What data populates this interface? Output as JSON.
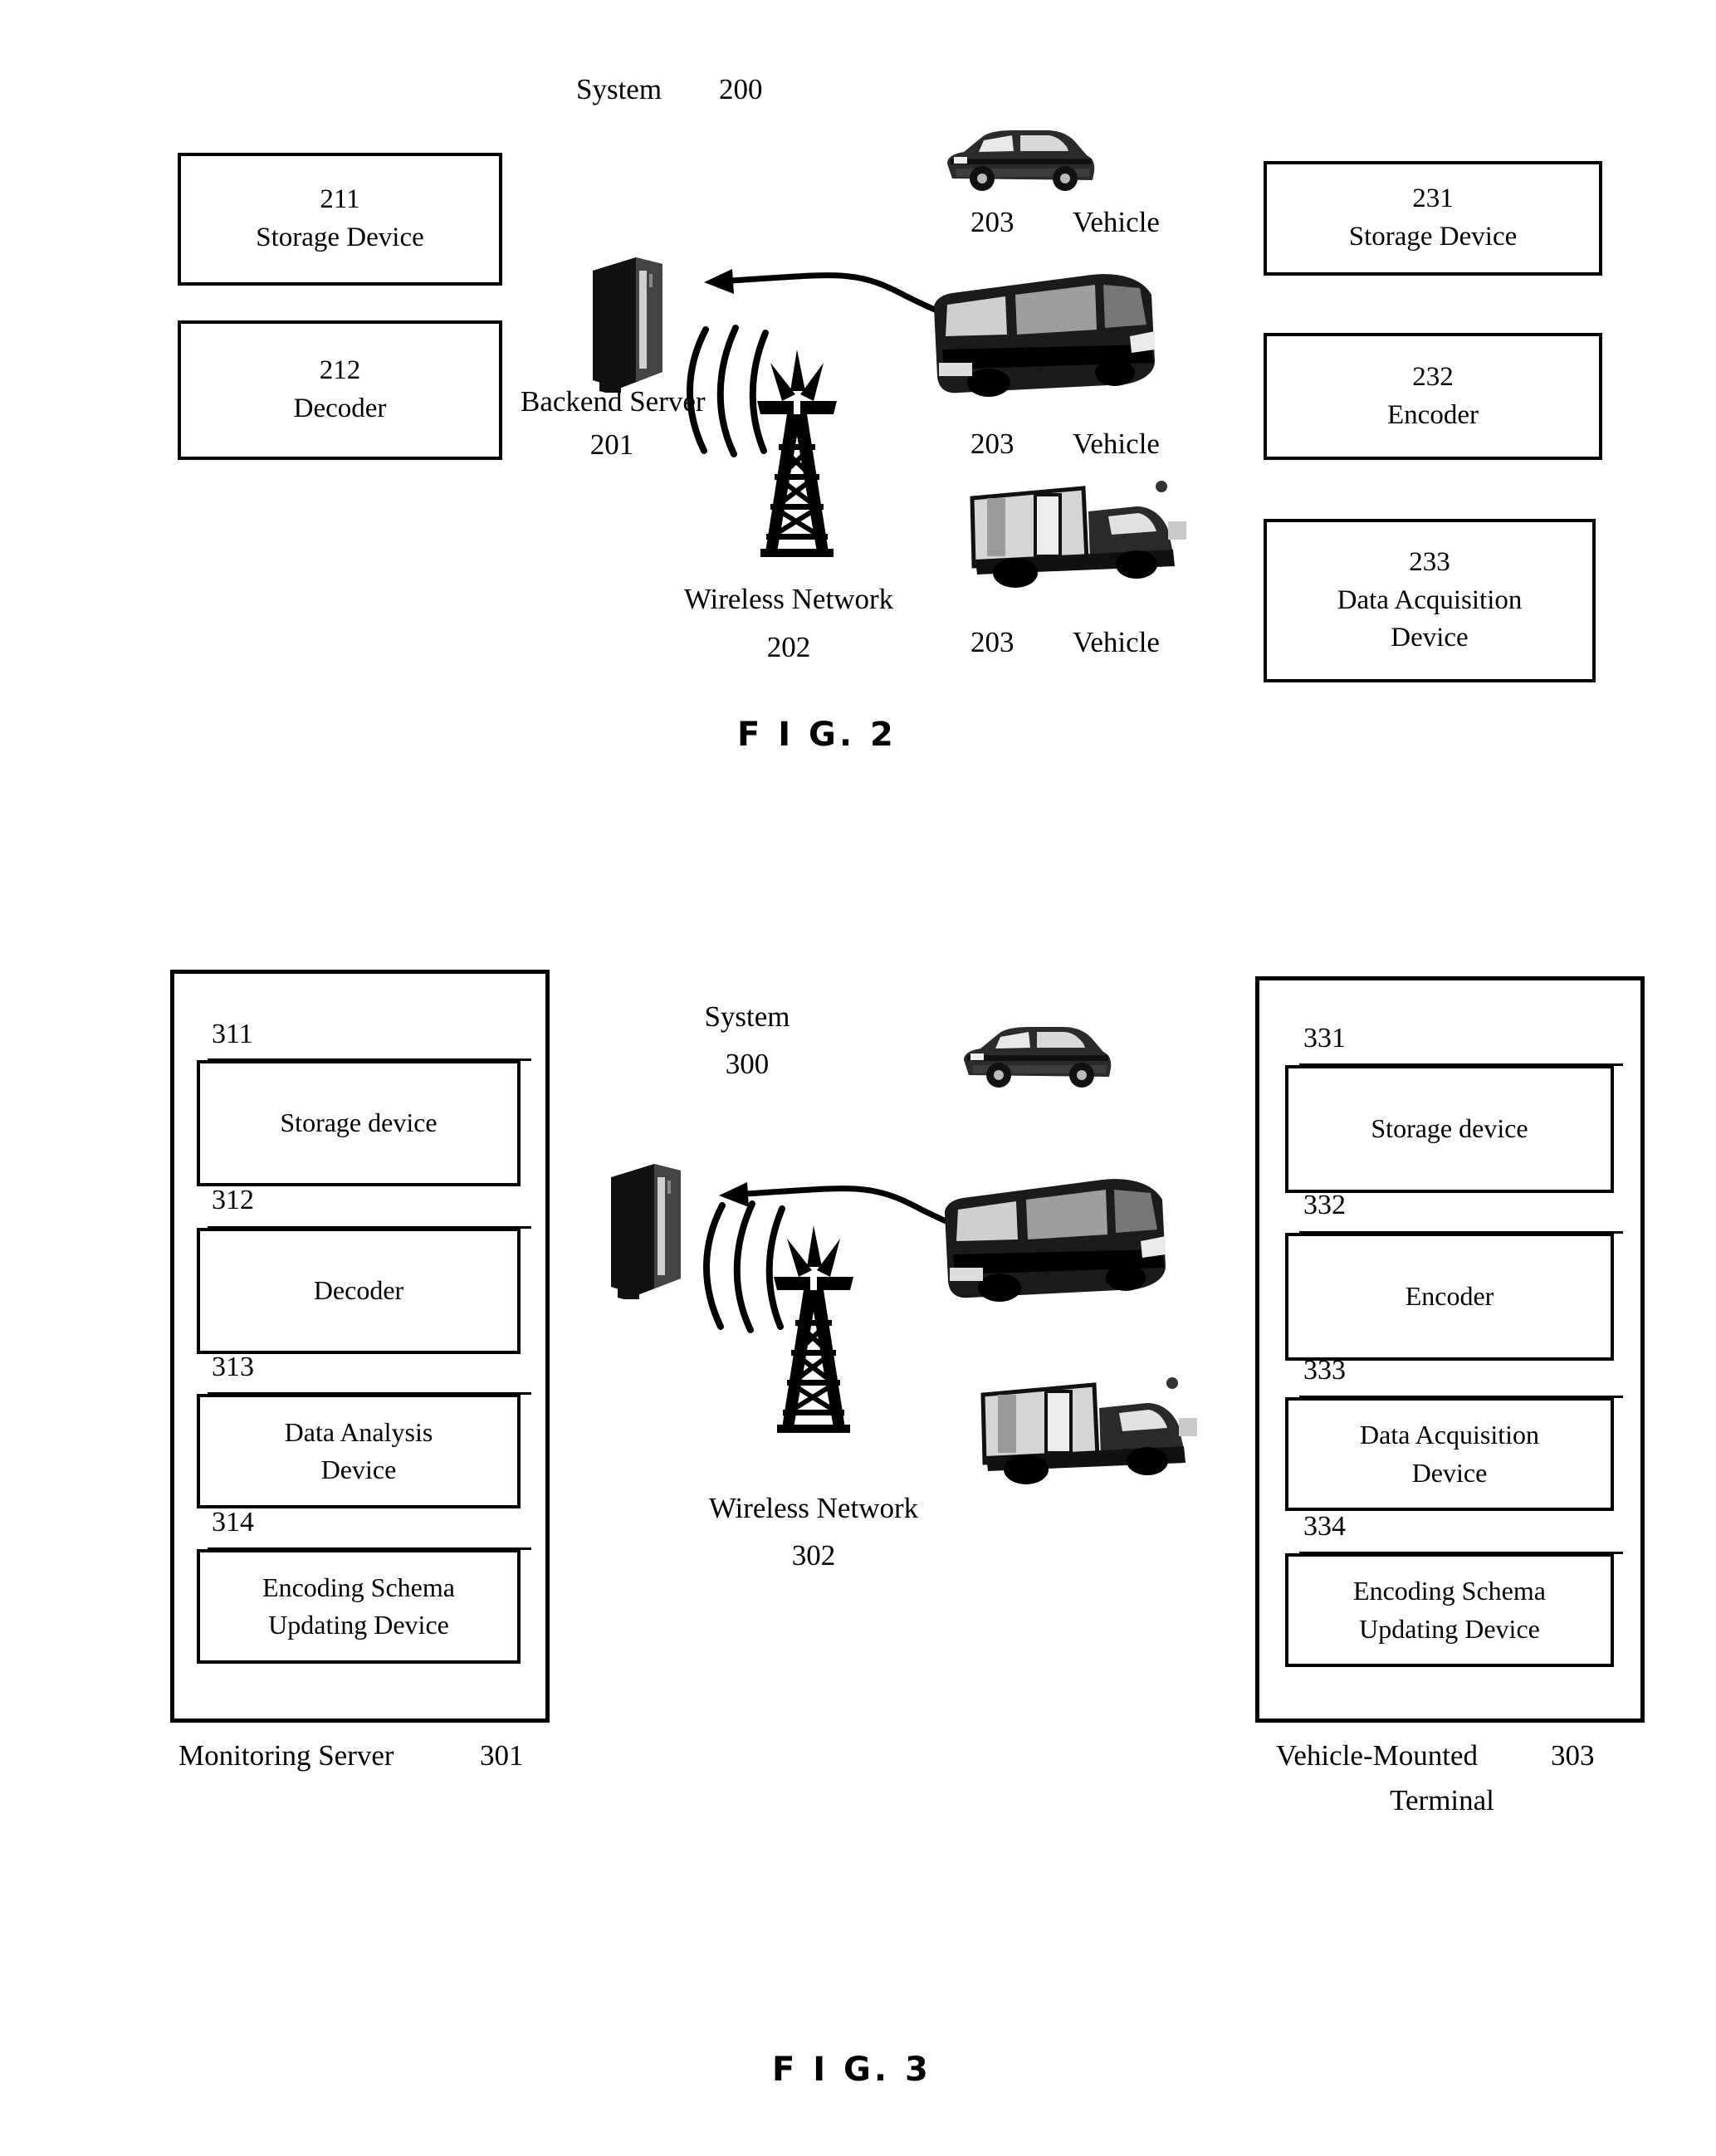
{
  "figures": [
    {
      "id": "fig2",
      "caption": "F I G. 2",
      "system_label": "System",
      "system_number": "200",
      "left_boxes": [
        {
          "number": "211",
          "label": "Storage Device"
        },
        {
          "number": "212",
          "label": "Decoder"
        }
      ],
      "right_boxes": [
        {
          "number": "231",
          "label": "Storage Device"
        },
        {
          "number": "232",
          "label": "Encoder"
        },
        {
          "number": "233",
          "label": "Data Acquisition Device"
        }
      ],
      "server_label": "Backend Server",
      "server_number": "201",
      "network_label": "Wireless Network",
      "network_number": "202",
      "vehicles": [
        {
          "number": "203",
          "label": "Vehicle",
          "type": "car"
        },
        {
          "number": "203",
          "label": "Vehicle",
          "type": "bus"
        },
        {
          "number": "203",
          "label": "Vehicle",
          "type": "truck"
        }
      ]
    },
    {
      "id": "fig3",
      "caption": "F I G. 3",
      "system_label": "System",
      "system_number": "300",
      "left_panel": {
        "title": "Monitoring Server",
        "number": "301",
        "items": [
          {
            "number": "311",
            "label": "Storage device"
          },
          {
            "number": "312",
            "label": "Decoder"
          },
          {
            "number": "313",
            "label": "Data Analysis Device"
          },
          {
            "number": "314",
            "label": "Encoding Schema Updating Device"
          }
        ]
      },
      "right_panel": {
        "title_line1": "Vehicle-Mounted",
        "title_line2": "Terminal",
        "number": "303",
        "items": [
          {
            "number": "331",
            "label": "Storage device"
          },
          {
            "number": "332",
            "label": "Encoder"
          },
          {
            "number": "333",
            "label": "Data Acquisition Device"
          },
          {
            "number": "334",
            "label": "Encoding Schema Updating Device"
          }
        ]
      },
      "network_label": "Wireless Network",
      "network_number": "302",
      "vehicle_types": [
        "car",
        "bus",
        "truck"
      ]
    }
  ],
  "colors": {
    "ink": "#000000",
    "paper": "#ffffff"
  }
}
